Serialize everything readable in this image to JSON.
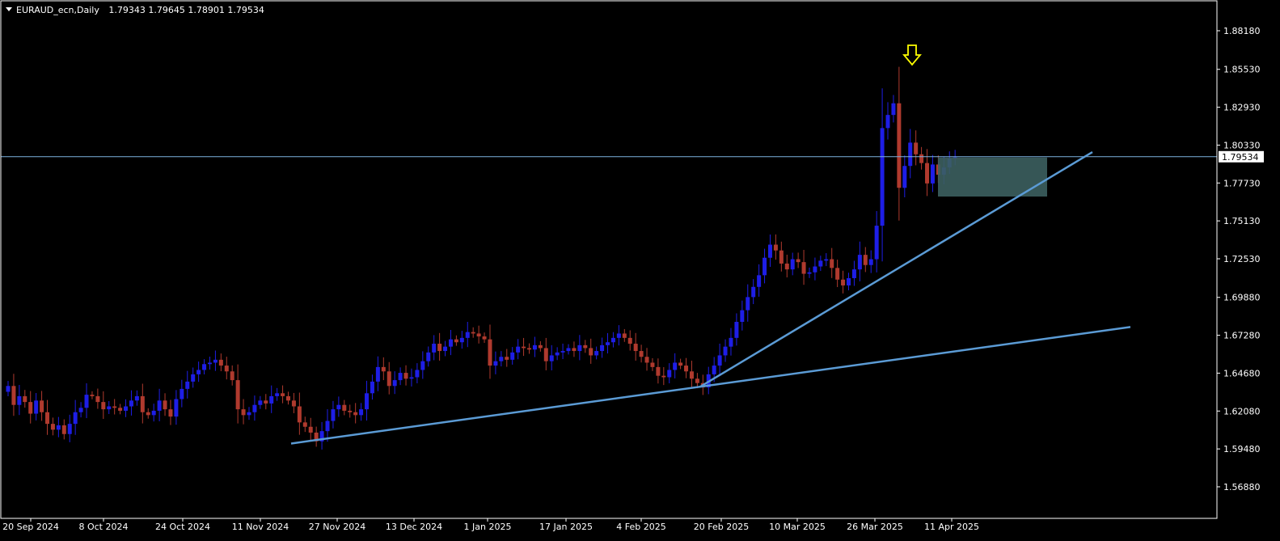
{
  "header": {
    "symbol": "EURAUD_ecn,Daily",
    "ohlc": "1.79343 1.79645 1.78901 1.79534"
  },
  "price_badge": "1.79534",
  "colors": {
    "background": "#000000",
    "frame": "#ffffff",
    "bull": "#1e1ee6",
    "bear": "#b03a2e",
    "trendline": "#5b9bd5",
    "hline": "#7eb2e0",
    "box": "#3c5f5f",
    "arrow": "#ffff00"
  },
  "chart_data": {
    "type": "candlestick",
    "timeframe": "Daily",
    "last_price": 1.79534,
    "y_ticks": [
      "1.88180",
      "1.85530",
      "1.82930",
      "1.80330",
      "1.77730",
      "1.75130",
      "1.72530",
      "1.69880",
      "1.67280",
      "1.64680",
      "1.62080",
      "1.59480",
      "1.56880"
    ],
    "x_ticks": [
      "20 Sep 2024",
      "8 Oct 2024",
      "24 Oct 2024",
      "11 Nov 2024",
      "27 Nov 2024",
      "13 Dec 2024",
      "1 Jan 2025",
      "17 Jan 2025",
      "4 Feb 2025",
      "20 Feb 2025",
      "10 Mar 2025",
      "26 Mar 2025",
      "11 Apr 2025"
    ],
    "ylim": [
      1.5588,
      1.8818
    ],
    "closes": [
      1.638,
      1.625,
      1.631,
      1.627,
      1.619,
      1.628,
      1.62,
      1.612,
      1.608,
      1.611,
      1.605,
      1.612,
      1.62,
      1.623,
      1.632,
      1.631,
      1.627,
      1.622,
      1.624,
      1.623,
      1.621,
      1.624,
      1.628,
      1.631,
      1.62,
      1.618,
      1.621,
      1.628,
      1.622,
      1.617,
      1.629,
      1.636,
      1.641,
      1.646,
      1.649,
      1.653,
      1.654,
      1.656,
      1.652,
      1.648,
      1.642,
      1.622,
      1.618,
      1.62,
      1.625,
      1.628,
      1.626,
      1.631,
      1.633,
      1.631,
      1.628,
      1.624,
      1.613,
      1.61,
      1.606,
      1.6,
      1.607,
      1.614,
      1.622,
      1.625,
      1.621,
      1.62,
      1.618,
      1.622,
      1.633,
      1.641,
      1.651,
      1.648,
      1.638,
      1.642,
      1.647,
      1.643,
      1.644,
      1.649,
      1.655,
      1.661,
      1.667,
      1.662,
      1.665,
      1.67,
      1.668,
      1.671,
      1.675,
      1.674,
      1.672,
      1.67,
      1.652,
      1.655,
      1.658,
      1.656,
      1.661,
      1.665,
      1.664,
      1.663,
      1.666,
      1.664,
      1.655,
      1.659,
      1.661,
      1.662,
      1.664,
      1.662,
      1.666,
      1.664,
      1.659,
      1.662,
      1.666,
      1.668,
      1.671,
      1.674,
      1.671,
      1.667,
      1.662,
      1.658,
      1.654,
      1.651,
      1.645,
      1.644,
      1.649,
      1.654,
      1.652,
      1.648,
      1.643,
      1.64,
      1.637,
      1.646,
      1.652,
      1.659,
      1.665,
      1.671,
      1.682,
      1.69,
      1.699,
      1.706,
      1.714,
      1.726,
      1.735,
      1.731,
      1.722,
      1.718,
      1.725,
      1.723,
      1.715,
      1.716,
      1.72,
      1.724,
      1.725,
      1.719,
      1.711,
      1.707,
      1.712,
      1.718,
      1.728,
      1.721,
      1.725,
      1.748,
      1.815,
      1.824,
      1.832,
      1.774,
      1.789,
      1.805,
      1.797,
      1.791,
      1.777,
      1.79,
      1.783,
      1.788,
      1.794,
      1.795
    ]
  }
}
